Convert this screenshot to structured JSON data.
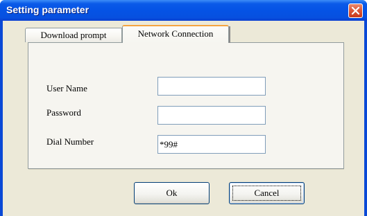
{
  "window": {
    "title": "Setting parameter",
    "close_icon": "close-icon"
  },
  "tabs": [
    {
      "label": "Download prompt",
      "active": false
    },
    {
      "label": "Network Connection",
      "active": true
    }
  ],
  "form": {
    "user_name_label": "User Name",
    "user_name_value": "",
    "password_label": "Password",
    "password_value": "",
    "dial_number_label": "Dial Number",
    "dial_number_value": "*99#"
  },
  "buttons": {
    "ok_label": "Ok",
    "cancel_label": "Cancel"
  },
  "colors": {
    "titlebar": "#0553e5",
    "client": "#ece9d8",
    "close_button": "#dd5a3a",
    "active_tab_highlight": "#f4a440"
  }
}
